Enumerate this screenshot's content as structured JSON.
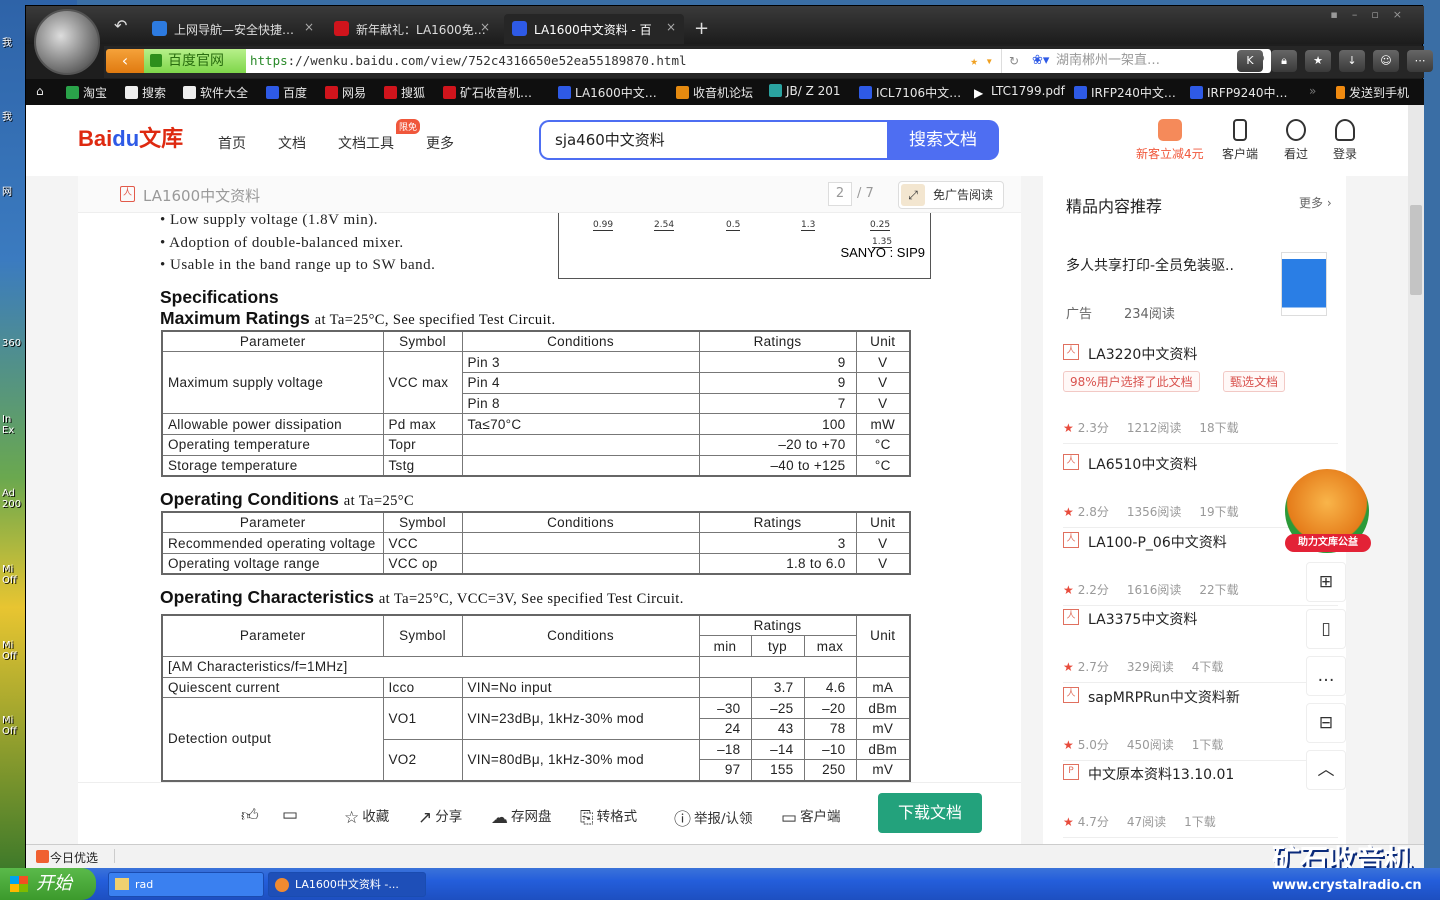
{
  "desktop": {
    "icons": [
      "我",
      "网",
      "360",
      "In Ex",
      "Ad 200",
      "Mi Off",
      "Mi Off",
      "Mi Off"
    ],
    "watermark_logo": "矿石收音机",
    "watermark_url": "www.crystalradio.cn"
  },
  "browser": {
    "tabs": [
      {
        "label": "上网导航—安全快捷…",
        "icon_color": "#2d7be0"
      },
      {
        "label": "新年献礼：LA1600免…",
        "icon_color": "#d0141c"
      },
      {
        "label": "LA1600中文资料 - 百",
        "icon_color": "#2e5ae6"
      }
    ],
    "new_tab": "+",
    "back": "‹",
    "security_label": "百度官网",
    "url_protocol": "https",
    "url_rest": "://wenku.baidu.com/view/752c4316650e52ea55189870.html",
    "search_placeholder": "湖南郴州一架直…",
    "toolbar_buttons": [
      "K",
      "lock-icon",
      "star-icon",
      "download-icon",
      "game-icon",
      "more-icon"
    ],
    "bookmarks": [
      {
        "label": "淘宝",
        "color": "#2aa34a"
      },
      {
        "label": "搜索",
        "color": "#eee"
      },
      {
        "label": "软件大全",
        "color": "#eee"
      },
      {
        "label": "百度",
        "color": "#2e5ae6"
      },
      {
        "label": "网易",
        "color": "#d0141c"
      },
      {
        "label": "搜狐",
        "color": "#d0141c"
      },
      {
        "label": "矿石收音机…",
        "color": "#d0141c"
      },
      {
        "label": "LA1600中文…",
        "color": "#2e5ae6"
      },
      {
        "label": "收音机论坛",
        "color": "#e58a10"
      },
      {
        "label": "JB/ Z 201",
        "color": "#2aa3a0"
      },
      {
        "label": "ICL7106中文…",
        "color": "#2e5ae6"
      },
      {
        "label": "LTC1799.pdf",
        "color": "#fff"
      },
      {
        "label": "IRFP240中文…",
        "color": "#2e5ae6"
      },
      {
        "label": "IRFP9240中…",
        "color": "#2e5ae6"
      }
    ],
    "bookmarks_overflow": "»",
    "send_to_phone": "发送到手机",
    "status_item": "今日优选"
  },
  "wenku": {
    "logo": "Bai度文库",
    "nav": [
      "首页",
      "文档",
      "文档工具",
      "更多"
    ],
    "nav_badge": "限免",
    "search_value": "sja460中文资料",
    "search_button": "搜索文档",
    "header_actions": [
      "新客立减4元",
      "客户端",
      "看过",
      "登录"
    ],
    "doc_title": "LA1600中文资料",
    "page_current": "2",
    "page_total": "/ 7",
    "no_ad_button": "免广告阅读",
    "bottom_actions": [
      "收藏",
      "分享",
      "存网盘",
      "转格式",
      "举报/认领",
      "客户端"
    ],
    "download_button": "下载文档",
    "accent": "#4e6ef2",
    "download_color": "#23a27c"
  },
  "document": {
    "bullets": [
      "• Low supply voltage (1.8V min).",
      "• Adoption of double-balanced mixer.",
      "• Usable in the band range up to SW band."
    ],
    "package_dims": [
      "0.99",
      "2.54",
      "0.5",
      "1.3",
      "0.25",
      "1.35"
    ],
    "package_label": "SANYO : SIP9",
    "specifications_heading": "Specifications",
    "max_ratings": {
      "heading": "Maximum Ratings",
      "note": "at Ta=25°C, See specified Test Circuit."
    },
    "op_conditions": {
      "heading": "Operating Conditions",
      "note": "at Ta=25°C"
    },
    "op_characteristics": {
      "heading": "Operating Characteristics",
      "note": "at Ta=25°C, VCC=3V, See specified Test Circuit."
    },
    "table_max": [
      [
        {
          "t": "Parameter",
          "a": "c"
        },
        {
          "t": "Symbol",
          "a": "c"
        },
        {
          "t": "Conditions",
          "a": "c"
        },
        {
          "t": "Ratings",
          "a": "c"
        },
        {
          "t": "Unit",
          "a": "c"
        }
      ],
      [
        {
          "t": "Maximum supply voltage",
          "rs": 3
        },
        {
          "t": "VCC max",
          "rs": 3
        },
        {
          "t": "Pin 3"
        },
        {
          "t": "9",
          "a": "r"
        },
        {
          "t": "V",
          "a": "c"
        }
      ],
      [
        {
          "t": "Pin 4"
        },
        {
          "t": "9",
          "a": "r"
        },
        {
          "t": "V",
          "a": "c"
        }
      ],
      [
        {
          "t": "Pin 8"
        },
        {
          "t": "7",
          "a": "r"
        },
        {
          "t": "V",
          "a": "c"
        }
      ],
      [
        {
          "t": "Allowable power dissipation"
        },
        {
          "t": "Pd max"
        },
        {
          "t": "Ta≤70°C"
        },
        {
          "t": "100",
          "a": "r"
        },
        {
          "t": "mW",
          "a": "c"
        }
      ],
      [
        {
          "t": "Operating temperature"
        },
        {
          "t": "Topr"
        },
        {
          "t": ""
        },
        {
          "t": "–20  to  +70",
          "a": "r"
        },
        {
          "t": "°C",
          "a": "c"
        }
      ],
      [
        {
          "t": "Storage temperature"
        },
        {
          "t": "Tstg"
        },
        {
          "t": ""
        },
        {
          "t": "–40  to  +125",
          "a": "r"
        },
        {
          "t": "°C",
          "a": "c"
        }
      ]
    ],
    "table_op": [
      [
        {
          "t": "Parameter",
          "a": "c"
        },
        {
          "t": "Symbol",
          "a": "c"
        },
        {
          "t": "Conditions",
          "a": "c"
        },
        {
          "t": "Ratings",
          "a": "c"
        },
        {
          "t": "Unit",
          "a": "c"
        }
      ],
      [
        {
          "t": "Recommended operating voltage"
        },
        {
          "t": "VCC"
        },
        {
          "t": ""
        },
        {
          "t": "3",
          "a": "r"
        },
        {
          "t": "V",
          "a": "c"
        }
      ],
      [
        {
          "t": "Operating voltage range"
        },
        {
          "t": "VCC op"
        },
        {
          "t": ""
        },
        {
          "t": "1.8  to  6.0",
          "a": "r"
        },
        {
          "t": "V",
          "a": "c"
        }
      ]
    ],
    "table_char": [
      [
        {
          "t": "Parameter",
          "a": "c",
          "rs": 2
        },
        {
          "t": "Symbol",
          "a": "c",
          "rs": 2
        },
        {
          "t": "Conditions",
          "a": "c",
          "rs": 2
        },
        {
          "t": "Ratings",
          "a": "c",
          "cs": 3
        },
        {
          "t": "Unit",
          "a": "c",
          "rs": 2
        }
      ],
      [
        {
          "t": "min",
          "a": "c"
        },
        {
          "t": "typ",
          "a": "c"
        },
        {
          "t": "max",
          "a": "c"
        }
      ],
      [
        {
          "t": "[AM Characteristics/f=1MHz]",
          "cs": 3
        },
        {
          "t": "",
          "cs": 3
        },
        {
          "t": ""
        }
      ],
      [
        {
          "t": "Quiescent current"
        },
        {
          "t": "Icco"
        },
        {
          "t": "VIN=No input"
        },
        {
          "t": ""
        },
        {
          "t": "3.7",
          "a": "r"
        },
        {
          "t": "4.6",
          "a": "r"
        },
        {
          "t": "mA",
          "a": "c"
        }
      ],
      [
        {
          "t": "Detection output",
          "rs": 4
        },
        {
          "t": "VO1",
          "rs": 2
        },
        {
          "t": "VIN=23dBμ, 1kHz-30% mod",
          "rs": 2
        },
        {
          "t": "–30",
          "a": "r"
        },
        {
          "t": "–25",
          "a": "r"
        },
        {
          "t": "–20",
          "a": "r"
        },
        {
          "t": "dBm",
          "a": "c"
        }
      ],
      [
        {
          "t": "24",
          "a": "r"
        },
        {
          "t": "43",
          "a": "r"
        },
        {
          "t": "78",
          "a": "r"
        },
        {
          "t": "mV",
          "a": "c"
        }
      ],
      [
        {
          "t": "VO2",
          "rs": 2
        },
        {
          "t": "VIN=80dBμ, 1kHz-30% mod",
          "rs": 2
        },
        {
          "t": "–18",
          "a": "r"
        },
        {
          "t": "–14",
          "a": "r"
        },
        {
          "t": "–10",
          "a": "r"
        },
        {
          "t": "dBm",
          "a": "c"
        }
      ],
      [
        {
          "t": "97",
          "a": "r"
        },
        {
          "t": "155",
          "a": "r"
        },
        {
          "t": "250",
          "a": "r"
        },
        {
          "t": "mV",
          "a": "c"
        }
      ]
    ]
  },
  "sidebar": {
    "title": "精品内容推荐",
    "more": "更多 ›",
    "ad": {
      "title": "多人共享打印-全员免装驱..",
      "label": "广告",
      "reads": "234阅读"
    },
    "items": [
      {
        "icon": "pdf",
        "title": "LA3220中文资料",
        "tags": [
          "98%用户选择了此文档",
          "甄选文档"
        ],
        "score": "2.3分",
        "reads": "1212阅读",
        "downloads": "18下载"
      },
      {
        "icon": "pdf",
        "title": "LA6510中文资料",
        "score": "2.8分",
        "reads": "1356阅读",
        "downloads": "19下载"
      },
      {
        "icon": "pdf",
        "title": "LA100-P_06中文资料",
        "score": "2.2分",
        "reads": "1616阅读",
        "downloads": "22下载"
      },
      {
        "icon": "pdf",
        "title": "LA3375中文资料",
        "score": "2.7分",
        "reads": "329阅读",
        "downloads": "4下载"
      },
      {
        "icon": "pdf",
        "title": "sapMRPRun中文资料新",
        "score": "5.0分",
        "reads": "450阅读",
        "downloads": "1下载"
      },
      {
        "icon": "ppt",
        "title": "中文原本资料13.10.01",
        "score": "4.7分",
        "reads": "47阅读",
        "downloads": "1下载"
      }
    ],
    "mascot_label": "助力文库公益"
  },
  "taskbar": {
    "start": "开始",
    "tasks": [
      "rad",
      "LA1600中文资料 -..."
    ]
  }
}
